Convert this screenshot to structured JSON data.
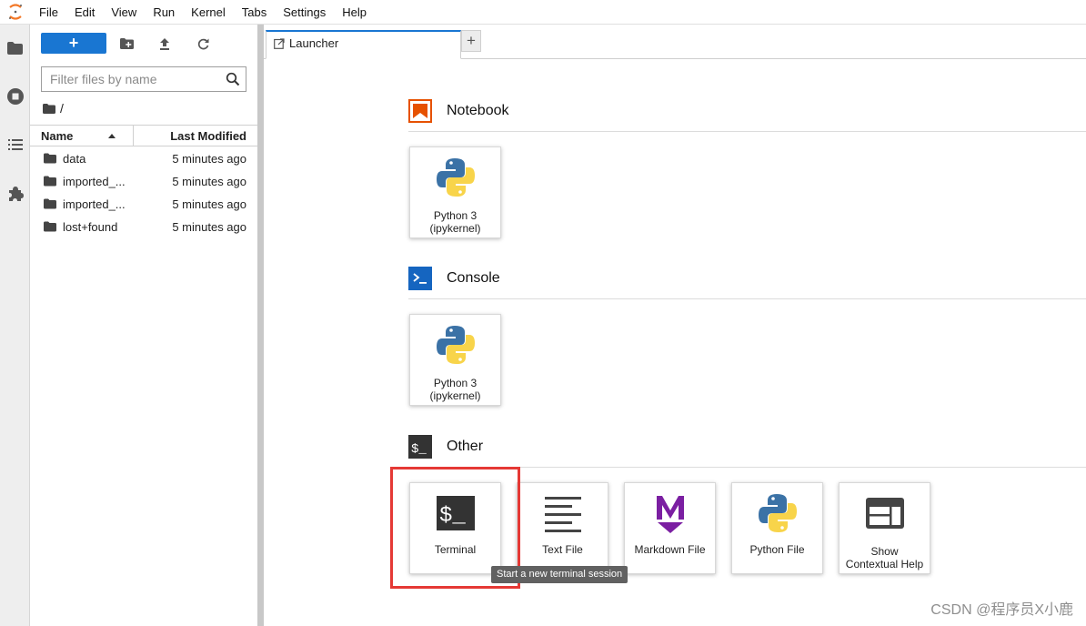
{
  "menubar": {
    "logo_icon": "jupyter-logo-icon",
    "items": [
      "File",
      "Edit",
      "View",
      "Run",
      "Kernel",
      "Tabs",
      "Settings",
      "Help"
    ]
  },
  "activitybar": {
    "icons": [
      "folder-icon",
      "running-stop-icon",
      "table-of-contents-icon",
      "extension-puzzle-icon"
    ]
  },
  "filebrowser": {
    "new_button_label": "+",
    "toolbar_icons": [
      "new-folder-icon",
      "upload-icon",
      "refresh-icon"
    ],
    "filter_placeholder": "Filter files by name",
    "filter_value": "",
    "breadcrumb": "/",
    "columns": {
      "name": "Name",
      "modified": "Last Modified"
    },
    "files": [
      {
        "name": "data",
        "modified": "5 minutes ago"
      },
      {
        "name": "imported_...",
        "modified": "5 minutes ago"
      },
      {
        "name": "imported_...",
        "modified": "5 minutes ago"
      },
      {
        "name": "lost+found",
        "modified": "5 minutes ago"
      }
    ]
  },
  "tabs": {
    "active_label": "Launcher",
    "add_label": "+"
  },
  "launcher": {
    "notebook": {
      "title": "Notebook",
      "cards": [
        {
          "label1": "Python 3",
          "label2": "(ipykernel)"
        }
      ]
    },
    "console": {
      "title": "Console",
      "cards": [
        {
          "label1": "Python 3",
          "label2": "(ipykernel)"
        }
      ]
    },
    "other": {
      "title": "Other",
      "cards": [
        {
          "label1": "Terminal"
        },
        {
          "label1": "Text File"
        },
        {
          "label1": "Markdown File"
        },
        {
          "label1": "Python File"
        },
        {
          "label1": "Show",
          "label2": "Contextual Help"
        }
      ]
    }
  },
  "tooltip": "Start a new terminal session",
  "watermark": "CSDN @程序员X小鹿",
  "colors": {
    "accent": "#1976d2",
    "notebook_icon": "#e65100",
    "console_icon": "#1565c0",
    "highlight": "#e53935"
  }
}
